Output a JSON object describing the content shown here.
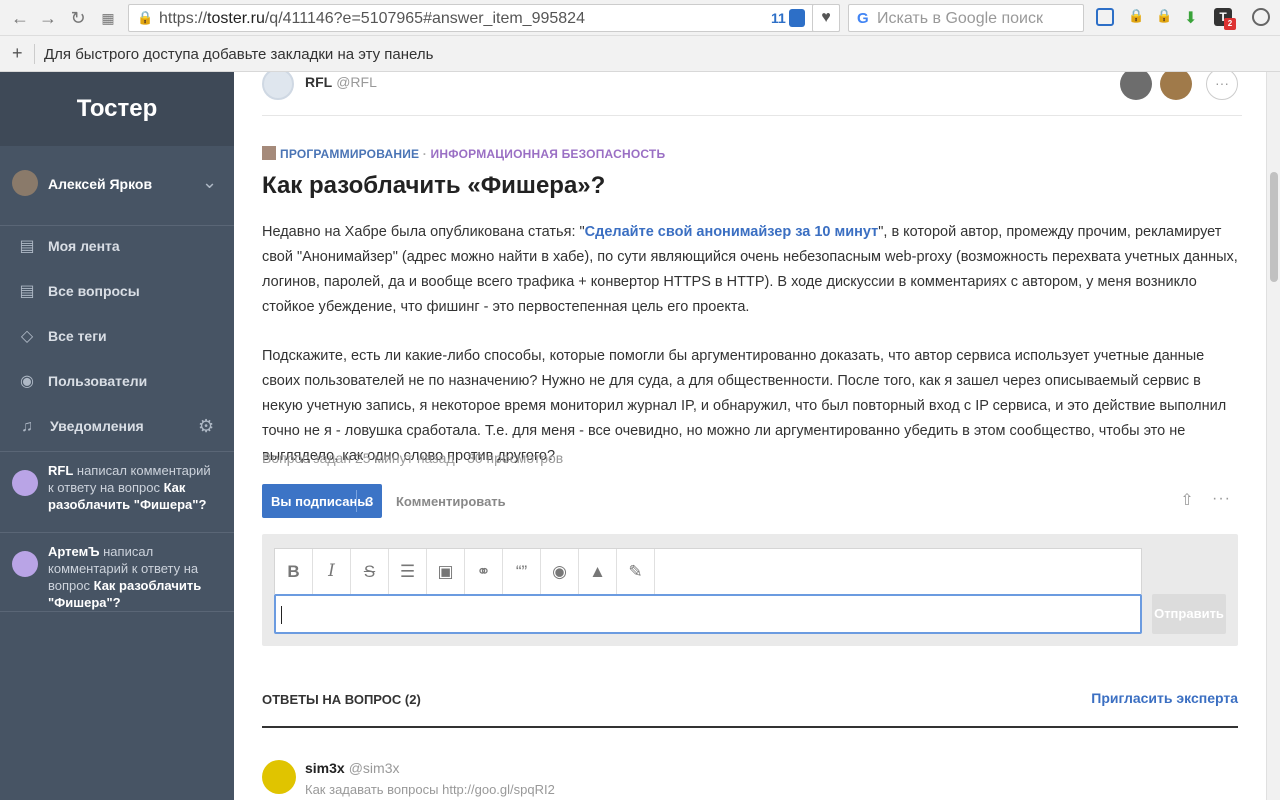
{
  "browser": {
    "url_prefix": "https://",
    "url_host": "toster.ru",
    "url_path": "/q/411146?e=5107965#answer_item_995824",
    "url_badge": "11",
    "search_placeholder": "Искать в Google поиск",
    "bookmarks_hint": "Для быстрого доступа добавьте закладки на эту панель",
    "ext_badge": "2"
  },
  "sidebar": {
    "brand": "Тостер",
    "user_name": "Алексей Ярков",
    "items": [
      {
        "label": "Моя лента",
        "icon": "feed-icon"
      },
      {
        "label": "Все вопросы",
        "icon": "list-icon"
      },
      {
        "label": "Все теги",
        "icon": "tag-icon"
      },
      {
        "label": "Пользователи",
        "icon": "users-icon"
      },
      {
        "label": "Уведомления",
        "icon": "bell-icon"
      }
    ],
    "notifications": [
      {
        "author": "RFL",
        "text": " написал комментарий к ответу на вопрос ",
        "link": "Как разоблачить \"Фишера\"?"
      },
      {
        "author": "АртемЪ",
        "text": " написал комментарий к ответу на вопрос ",
        "link": "Как разоблачить \"Фишера\"?"
      }
    ]
  },
  "question": {
    "author_name": "RFL",
    "author_nick": "@RFL",
    "tag1": "ПРОГРАММИРОВАНИЕ",
    "tag_sep": " · ",
    "tag2": "ИНФОРМАЦИОННАЯ БЕЗОПАСНОСТЬ",
    "title": "Как разоблачить «Фишера»?",
    "p1_before": "Недавно на Хабре была опубликована статья: \"",
    "p1_link": "Сделайте свой анонимайзер за 10 минут",
    "p1_after": "\", в которой автор, промежду прочим, рекламирует свой \"Анонимайзер\" (адрес можно найти в хабе), по сути являющийся очень небезопасным web-proxy (возможность перехвата учетных данных, логинов, паролей, да и вообще всего трафика + конвертор HTTPS в HTTP). В ходе дискуссии в комментариях с автором, у меня возникло стойкое убеждение, что фишинг - это первостепенная цель его проекта.",
    "p2": "Подскажите, есть ли какие-либо способы, которые помогли бы аргументированно доказать, что автор сервиса использует учетные данные своих пользователей не по назначению? Нужно не для суда, а для общественности. После того, как я зашел через описываемый сервис в некую учетную запись, я некоторое время мониторил журнал IP, и обнаружил, что был повторный вход с IP сервиса, и это действие выполнил точно не я - ловушка сработала. Т.е. для меня - все очевидно, но можно ли аргументированно убедить в этом сообщество, чтобы это не выглядело, как одно слово против другого?",
    "meta": "Вопрос задан 25 минут назад · 30 просмотров",
    "subscribe_label": "Вы подписаны",
    "subscribe_count": "3",
    "comment_label": "Комментировать",
    "send_label": "Отправить"
  },
  "answers": {
    "title": "ОТВЕТЫ НА ВОПРОС (2)",
    "invite": "Пригласить эксперта",
    "first_name": "sim3x",
    "first_nick": "@sim3x",
    "first_desc": "Как задавать вопросы http://goo.gl/spqRI2"
  },
  "colors": {
    "sidebar_bg": "#475464",
    "brand_bg": "#3e4957",
    "accent": "#3c74c6",
    "tag_purple": "#9a6fc4"
  }
}
